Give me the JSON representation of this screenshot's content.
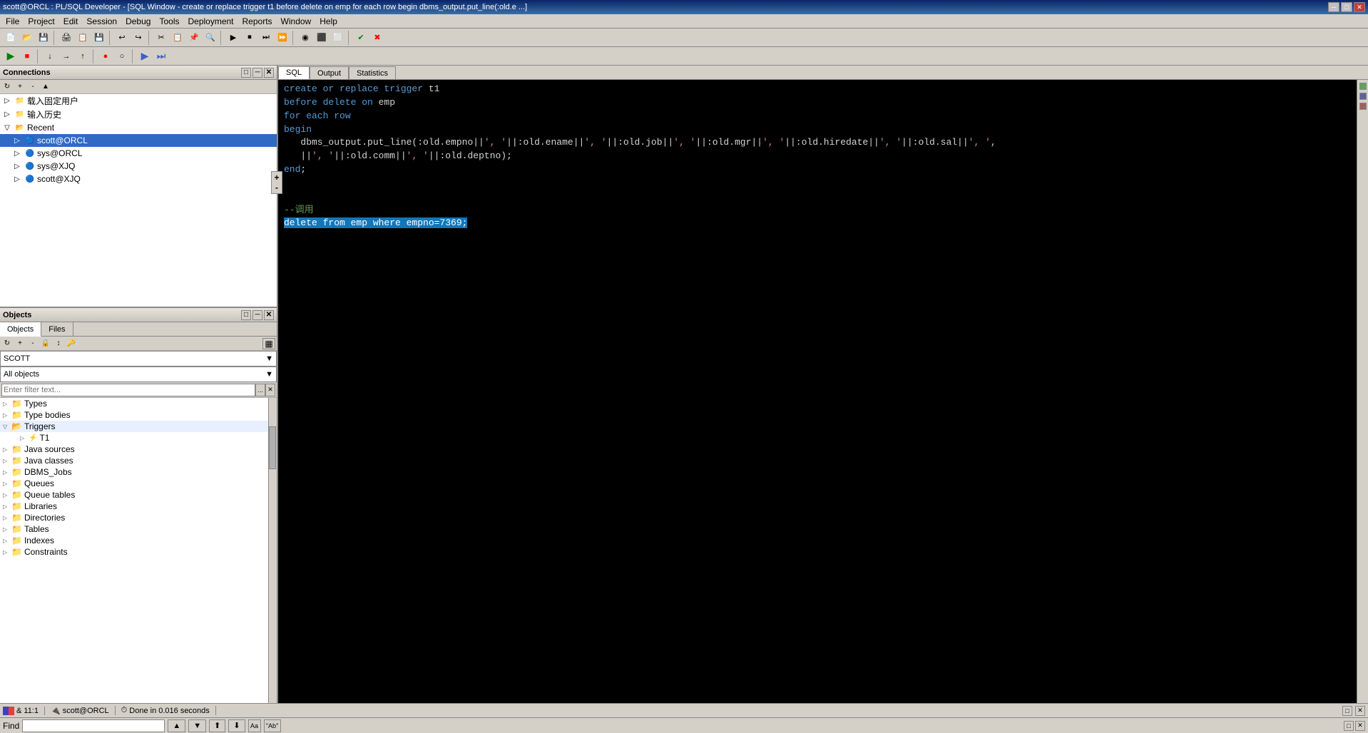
{
  "window": {
    "title": "scott@ORCL : PL/SQL Developer - [SQL Window - create or replace trigger t1 before delete on emp for each row begin dbms_output.put_line(:old.e ...]"
  },
  "menu": {
    "items": [
      "File",
      "Project",
      "Edit",
      "Session",
      "Debug",
      "Tools",
      "Deployment",
      "Reports",
      "Window",
      "Help"
    ]
  },
  "connections_panel": {
    "title": "Connections",
    "tree": [
      {
        "level": 1,
        "type": "folder",
        "label": "载入固定用户",
        "expanded": false
      },
      {
        "level": 1,
        "type": "folder",
        "label": "输入历史",
        "expanded": false
      },
      {
        "level": 1,
        "type": "folder",
        "label": "Recent",
        "expanded": true
      },
      {
        "level": 2,
        "type": "db",
        "label": "scott@ORCL",
        "expanded": false,
        "selected": true
      },
      {
        "level": 2,
        "type": "db",
        "label": "sys@ORCL",
        "expanded": false
      },
      {
        "level": 2,
        "type": "db",
        "label": "sys@XJQ",
        "expanded": false
      },
      {
        "level": 2,
        "type": "db",
        "label": "scott@XJQ",
        "expanded": false
      }
    ]
  },
  "objects_panel": {
    "title": "Objects",
    "tabs": [
      "Objects",
      "Files"
    ],
    "active_tab": "Objects",
    "schema": "SCOTT",
    "filter_placeholder": "Enter filter text...",
    "filter_value": "",
    "all_objects_label": "All objects",
    "tree": [
      {
        "level": 0,
        "type": "folder",
        "label": "Types",
        "expanded": false
      },
      {
        "level": 0,
        "type": "folder",
        "label": "Type bodies",
        "expanded": false
      },
      {
        "level": 0,
        "type": "folder",
        "label": "Triggers",
        "expanded": true
      },
      {
        "level": 1,
        "type": "trigger",
        "label": "T1",
        "expanded": false
      },
      {
        "level": 0,
        "type": "folder",
        "label": "Java sources",
        "expanded": false
      },
      {
        "level": 0,
        "type": "folder",
        "label": "Java classes",
        "expanded": false
      },
      {
        "level": 0,
        "type": "folder",
        "label": "DBMS_Jobs",
        "expanded": false
      },
      {
        "level": 0,
        "type": "folder",
        "label": "Queues",
        "expanded": false
      },
      {
        "level": 0,
        "type": "folder",
        "label": "Queue tables",
        "expanded": false
      },
      {
        "level": 0,
        "type": "folder",
        "label": "Libraries",
        "expanded": false
      },
      {
        "level": 0,
        "type": "folder",
        "label": "Directories",
        "expanded": false
      },
      {
        "level": 0,
        "type": "folder",
        "label": "Tables",
        "expanded": false
      },
      {
        "level": 0,
        "type": "folder",
        "label": "Indexes",
        "expanded": false
      },
      {
        "level": 0,
        "type": "folder",
        "label": "Constraints",
        "expanded": false
      }
    ]
  },
  "editor": {
    "tabs": [
      "SQL",
      "Output",
      "Statistics"
    ],
    "active_tab": "SQL",
    "code_lines": [
      "create or replace trigger t1",
      "before delete on emp",
      "for each row",
      "begin",
      "   dbms_output.put_line(:old.empno||', '||:old.ename||', '||:old.job||', '||:old.mgr||', '||:old.hiredate||', '||:old.sal||', '",
      "   ||', '||:old.comm||', '||:old.deptno);",
      "end;",
      "",
      "",
      "--调用",
      "delete from emp where empno=7369;"
    ],
    "selected_line_index": 10,
    "selected_text": "delete from emp where empno=7369;"
  },
  "status_bar": {
    "encoding": "& 11:1",
    "connection": "scott@ORCL",
    "message": "Done in 0.016 seconds"
  },
  "find_bar": {
    "label": "Find",
    "placeholder": "",
    "value": ""
  }
}
